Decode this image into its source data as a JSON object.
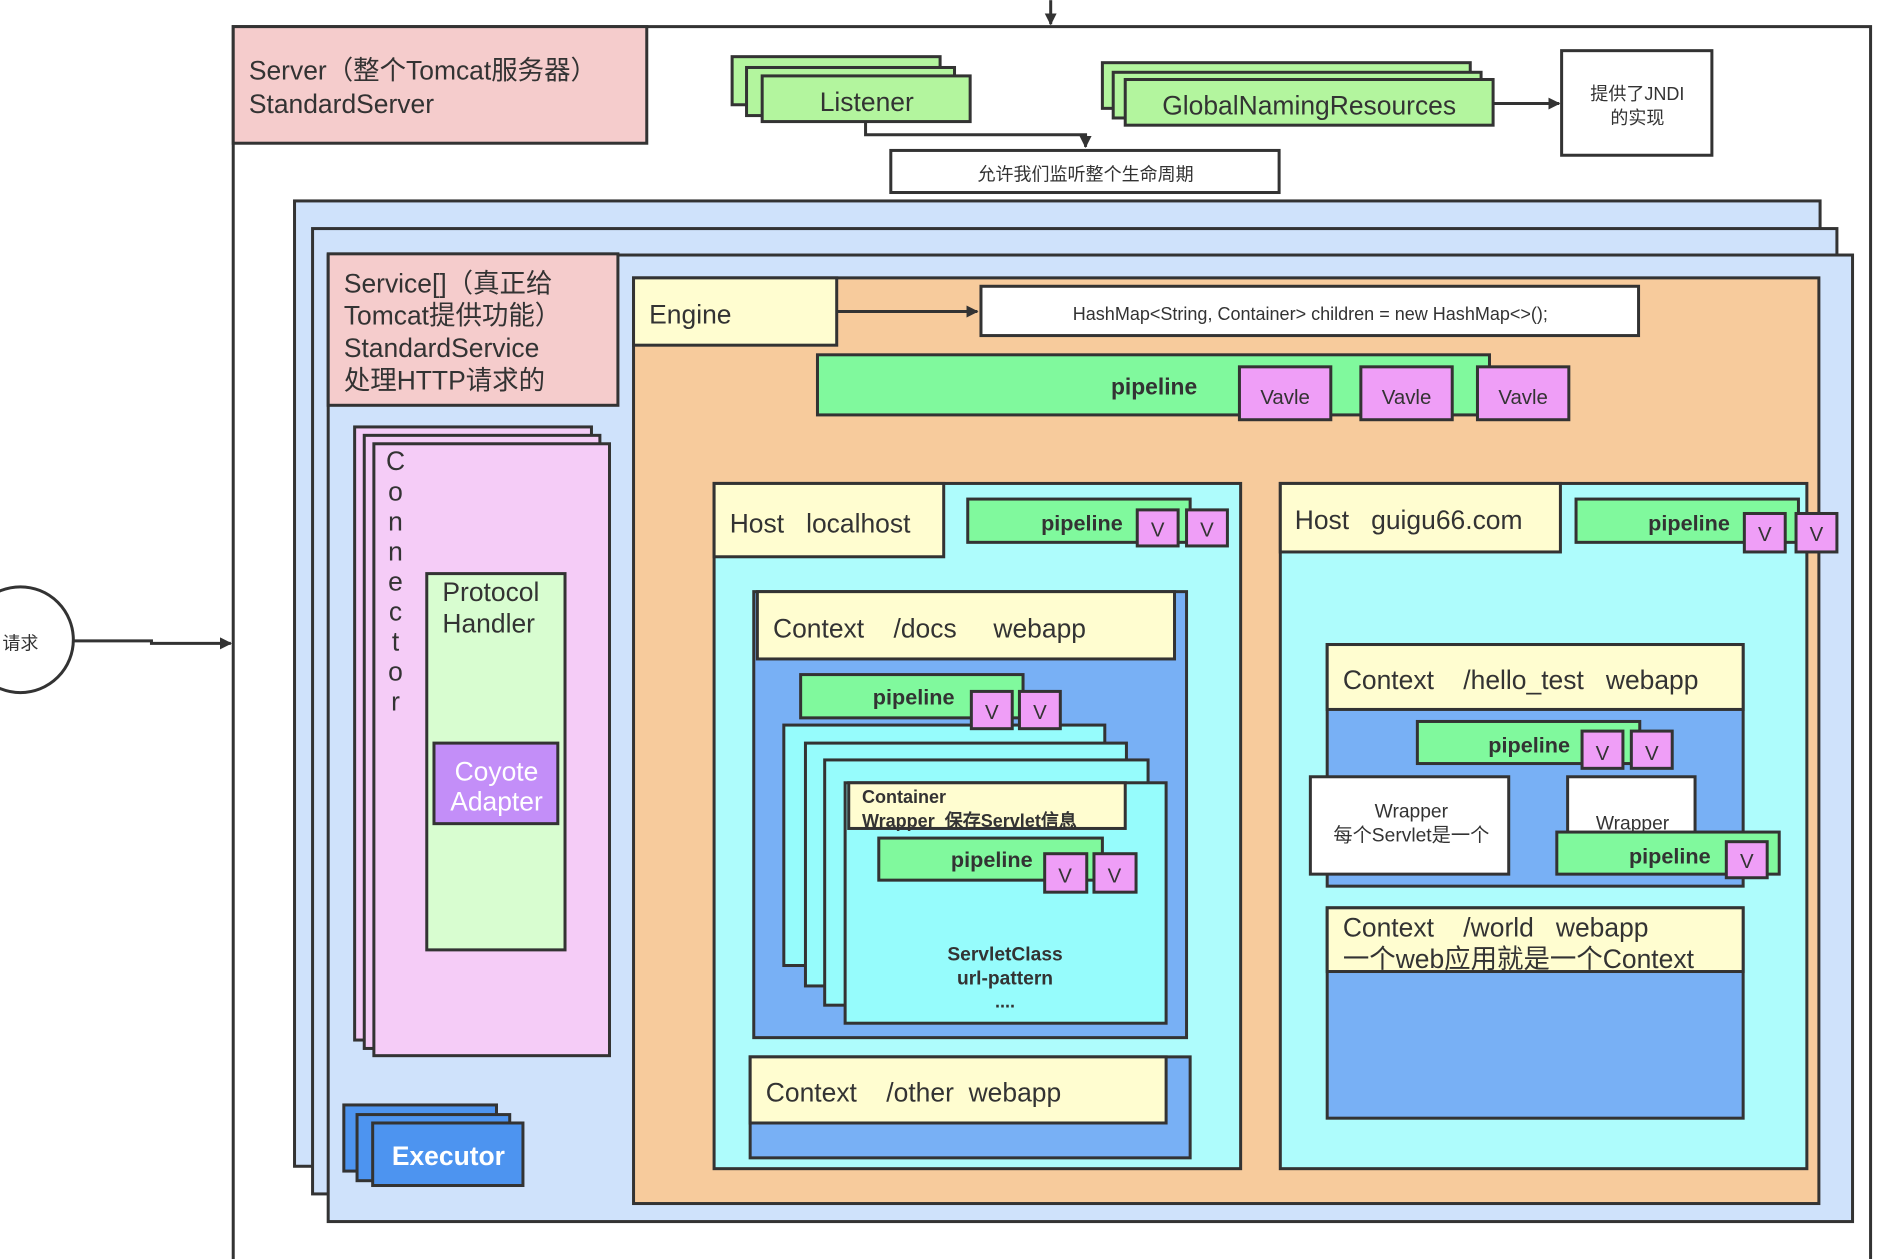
{
  "colors": {
    "server_label": "#f5cccc",
    "listener": "#b3f59e",
    "service": "#cfe2fb",
    "engine": "#f7cb9c",
    "label_yellow": "#fffdd0",
    "pipeline": "#80f99d",
    "valve": "#ef9ef7",
    "connector": "#f5ccf7",
    "protocol_handler": "#d8fdd0",
    "coyote_adapter": "#c38ef8",
    "executor": "#4d94f0",
    "host": "#aefcfc",
    "context": "#78b0f5",
    "wrapper": "#96fcfc"
  },
  "request": "请求",
  "server": {
    "line1": "Server（整个Tomcat服务器）",
    "line2": "StandardServer"
  },
  "listener": "Listener",
  "lifecycle_note": "允许我们监听整个生命周期",
  "global_naming": "GlobalNamingResources",
  "jndi_note": {
    "line1": "提供了JNDI",
    "line2": "的实现"
  },
  "service": {
    "line1": "Service[]（真正给",
    "line2": "Tomcat提供功能）",
    "line3": "StandardService",
    "line4": "处理HTTP请求的"
  },
  "connector_letters": [
    "C",
    "o",
    "n",
    "n",
    "e",
    "c",
    "t",
    "o",
    "r"
  ],
  "protocol_handler": {
    "line1": "Protocol",
    "line2": "Handler"
  },
  "coyote_adapter": {
    "line1": "Coyote",
    "line2": "Adapter"
  },
  "executor": "Executor",
  "engine": {
    "label": "Engine",
    "children_note": "HashMap<String, Container> children = new HashMap<>();",
    "pipeline": "pipeline",
    "valves": [
      "Vavle",
      "Vavle",
      "Vavle"
    ]
  },
  "host_localhost": {
    "label": "Host   localhost",
    "pipeline": "pipeline",
    "valve": "V",
    "context_docs": {
      "label": "Context    /docs     webapp",
      "pipeline": "pipeline",
      "wrapper": {
        "line1": "Container",
        "line2": "Wrapper  保存Servlet信息",
        "pipeline": "pipeline",
        "info1": "ServletClass",
        "info2": "url-pattern",
        "info3": "...."
      }
    },
    "context_other": {
      "label": "Context    /other  webapp"
    }
  },
  "host_guigu": {
    "label": "Host   guigu66.com",
    "pipeline": "pipeline",
    "context_hello": {
      "label": "Context    /hello_test   webapp",
      "pipeline": "pipeline",
      "wrapper1": {
        "line1": "Wrapper",
        "line2": "每个Servlet是一个"
      },
      "wrapper2": {
        "line1": "Wrapper",
        "pipeline": "pipeline"
      }
    },
    "context_world": {
      "line1": "Context    /world   webapp",
      "line2": "一个web应用就是一个Context"
    }
  }
}
